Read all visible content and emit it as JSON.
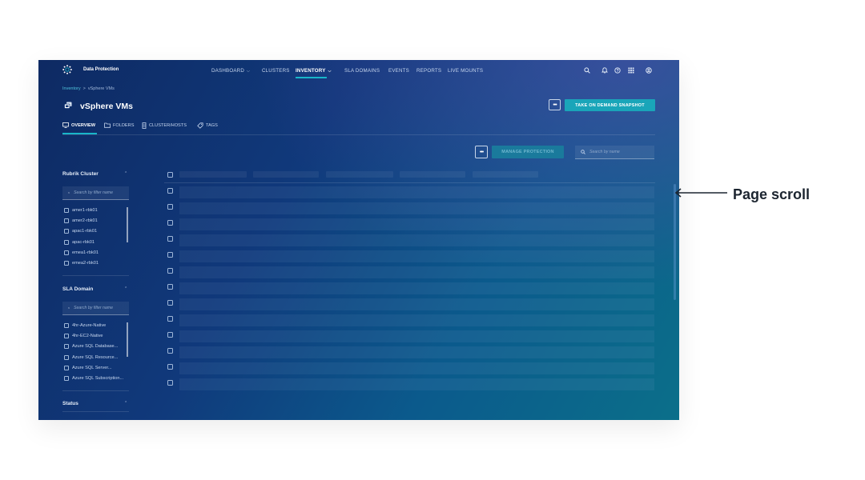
{
  "app": {
    "name": "Data Protection"
  },
  "nav": {
    "items": [
      {
        "label": "DASHBOARD",
        "chevron": true
      },
      {
        "label": "CLUSTERS",
        "chevron": false
      },
      {
        "label": "INVENTORY",
        "chevron": true,
        "active": true
      },
      {
        "label": "SLA DOMAINS",
        "chevron": false
      },
      {
        "label": "EVENTS",
        "chevron": false
      },
      {
        "label": "REPORTS",
        "chevron": false
      },
      {
        "label": "LIVE MOUNTS",
        "chevron": false
      }
    ],
    "icons": [
      "search-icon",
      "bell-icon",
      "help-icon",
      "apps-grid-icon",
      "user-icon"
    ]
  },
  "breadcrumb": {
    "parent": "Inventory",
    "separator": ">",
    "current": "vSphere VMs"
  },
  "page": {
    "title": "vSphere VMs",
    "more_label": "•••",
    "snapshot_label": "TAKE ON DEMAND SNAPSHOT"
  },
  "tabs": [
    {
      "label": "OVERVIEW",
      "icon": "monitor-icon",
      "active": true
    },
    {
      "label": "FOLDERS",
      "icon": "folder-icon"
    },
    {
      "label": "CLUSTER/HOSTS",
      "icon": "server-icon"
    },
    {
      "label": "TAGS",
      "icon": "tag-icon"
    }
  ],
  "toolbar": {
    "more_label": "•••",
    "manage_label": "MANAGE PROTECTION",
    "search_placeholder": "Search by name"
  },
  "filters": {
    "rubrik_cluster": {
      "title": "Rubrik Cluster",
      "search_placeholder": "Search by filter name",
      "items": [
        "amer1-rbk01",
        "amer2-rbk01",
        "apac1-rbk01",
        "apac-rbk01",
        "emea1-rbk01",
        "emea2-rbk01"
      ]
    },
    "sla_domain": {
      "title": "SLA Domain",
      "search_placeholder": "Search by filter name",
      "items": [
        "4hr-Azure-Native",
        "4hr-EC2-Native",
        "Azure SQL Database...",
        "Azure SQL Resource...",
        "Azure SQL Server...",
        "Azure SQL Subscription..."
      ]
    },
    "status": {
      "title": "Status"
    }
  },
  "table": {
    "row_count": 13,
    "header_columns": 5
  },
  "annotation": {
    "label": "Page scroll"
  },
  "colors": {
    "accent": "#1aa5b9",
    "underline": "#19b6c9",
    "link": "#4fc3dc"
  }
}
